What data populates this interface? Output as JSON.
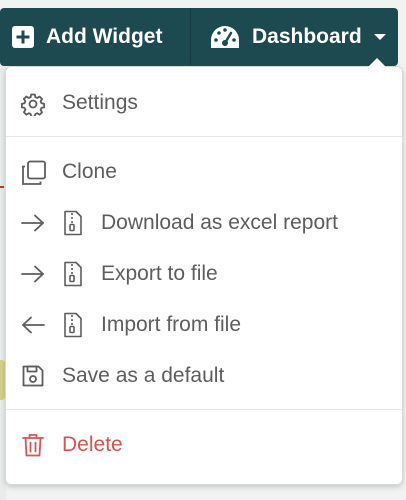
{
  "toolbar": {
    "add_widget_label": "Add Widget",
    "add_widget_icon": "plus-square-icon",
    "dashboard_label": "Dashboard",
    "dashboard_icon": "tachometer-icon",
    "caret_icon": "caret-down-icon",
    "background_color": "#1d4a50"
  },
  "menu": {
    "items": [
      {
        "label": "Settings",
        "icon": "gear-icon"
      },
      {
        "label": "Clone",
        "icon": "copy-icon"
      },
      {
        "label": "Download as excel report",
        "icon": "arrow-right-icon file-zip-icon"
      },
      {
        "label": "Export to file",
        "icon": "arrow-right-icon file-zip-icon"
      },
      {
        "label": "Import from file",
        "icon": "arrow-left-icon file-zip-icon"
      },
      {
        "label": "Save as a default",
        "icon": "floppy-disk-icon"
      },
      {
        "label": "Delete",
        "icon": "trash-icon"
      }
    ],
    "text_color": "#5d5d5d",
    "delete_color": "#d9534f"
  }
}
